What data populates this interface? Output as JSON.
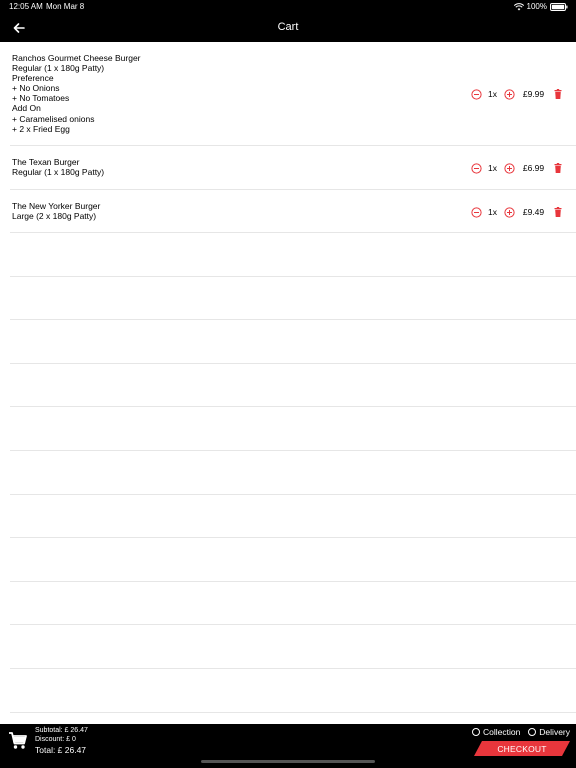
{
  "status": {
    "time": "12:05 AM",
    "date": "Mon Mar 8",
    "battery": "100%"
  },
  "nav": {
    "title": "Cart"
  },
  "items": [
    {
      "lines": [
        "Ranchos Gourmet Cheese Burger",
        "Regular (1 x 180g Patty)",
        "Preference",
        "+ No Onions",
        "+ No Tomatoes",
        "Add On",
        "+ Caramelised onions",
        "+ 2 x Fried Egg"
      ],
      "qty": "1x",
      "price": "£9.99"
    },
    {
      "lines": [
        "The Texan Burger",
        "Regular (1 x 180g Patty)"
      ],
      "qty": "1x",
      "price": "£6.99"
    },
    {
      "lines": [
        "The New Yorker Burger",
        "Large (2 x 180g Patty)"
      ],
      "qty": "1x",
      "price": "£9.49"
    }
  ],
  "footer": {
    "subtotal": "Subtotal: £ 26.47",
    "discount": "Discount: £ 0",
    "total": "Total: £ 26.47",
    "collection_label": "Collection",
    "delivery_label": "Delivery",
    "checkout_label": "CHECKOUT"
  },
  "colors": {
    "accent": "#e8363c",
    "bar": "#000000",
    "divider": "#e6e6e6"
  }
}
